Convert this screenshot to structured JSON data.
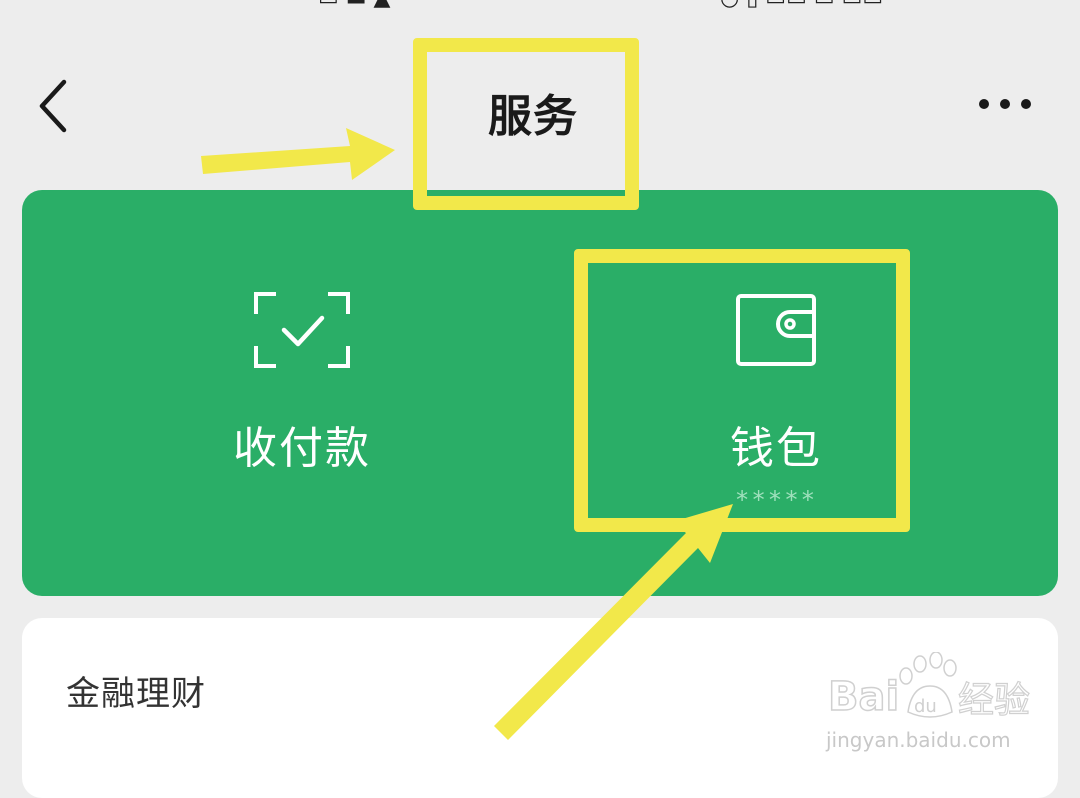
{
  "nav": {
    "title": "服务",
    "back_icon": "chevron-left-icon",
    "more_icon": "more-dots-icon"
  },
  "services": {
    "pay": {
      "label": "收付款",
      "icon": "scan-check-icon"
    },
    "wallet": {
      "label": "钱包",
      "masked_balance": "*****",
      "icon": "wallet-icon"
    }
  },
  "sections": {
    "finance_title": "金融理财"
  },
  "watermark": {
    "brand": "Baidu经验",
    "url": "jingyan.baidu.com"
  },
  "colors": {
    "page_background": "#ededed",
    "panel_green": "#2aae67",
    "annotation_yellow": "#f2e84a",
    "card_white": "#ffffff"
  }
}
